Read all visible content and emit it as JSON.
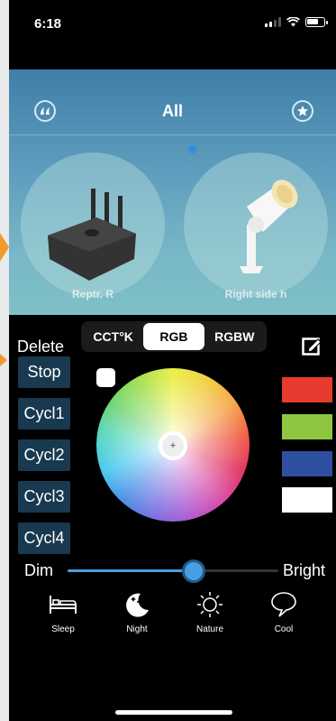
{
  "status_bar": {
    "time": "6:18"
  },
  "header": {
    "title": "All"
  },
  "devices": [
    {
      "name": "Reptr. R",
      "icon": "repeater-hub-icon"
    },
    {
      "name": "Right side h",
      "icon": "spotlight-icon"
    }
  ],
  "mode_tabs": [
    {
      "label": "CCT°K",
      "active": false
    },
    {
      "label": "RGB",
      "active": true
    },
    {
      "label": "RGBW",
      "active": false
    }
  ],
  "delete_label": "Delete",
  "effect_buttons": [
    "Stop",
    "Cycl1",
    "Cycl2",
    "Cycl3",
    "Cycl4"
  ],
  "color_swatches": [
    "#e63b2e",
    "#8fc63f",
    "#2f4fa0",
    "#ffffff"
  ],
  "brightness": {
    "min_label": "Dim",
    "max_label": "Bright",
    "value_percent": 60
  },
  "scenes": [
    {
      "label": "Sleep",
      "icon": "bed-icon"
    },
    {
      "label": "Night",
      "icon": "moon-stars-icon"
    },
    {
      "label": "Nature",
      "icon": "sun-icon"
    },
    {
      "label": "Cool",
      "icon": "speech-bubble-icon"
    }
  ]
}
